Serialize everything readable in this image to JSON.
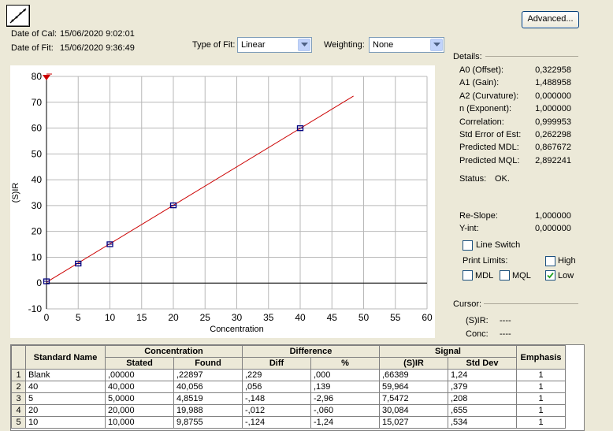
{
  "header": {
    "date_of_cal_label": "Date of Cal:",
    "date_of_cal": "15/06/2020 9:02:01",
    "date_of_fit_label": "Date of Fit:",
    "date_of_fit": "15/06/2020 9:36:49",
    "type_of_fit_label": "Type of Fit:",
    "type_of_fit": "Linear",
    "weighting_label": "Weighting:",
    "weighting": "None",
    "advanced_button": "Advanced..."
  },
  "details": {
    "title": "Details:",
    "rows": [
      {
        "label": "A0 (Offset):",
        "value": "0,322958"
      },
      {
        "label": "A1 (Gain):",
        "value": "1,488958"
      },
      {
        "label": "A2 (Curvature):",
        "value": "0,000000"
      },
      {
        "label": "n (Exponent):",
        "value": "1,000000"
      },
      {
        "label": "Correlation:",
        "value": "0,999953"
      },
      {
        "label": "Std Error of Est:",
        "value": "0,262298"
      },
      {
        "label": "Predicted MDL:",
        "value": "0,867672"
      },
      {
        "label": "Predicted MQL:",
        "value": "2,892241"
      }
    ],
    "status_label": "Status:",
    "status_value": "OK.",
    "reslope_label": "Re-Slope:",
    "reslope_value": "1,000000",
    "yint_label": "Y-int:",
    "yint_value": "0,000000",
    "line_switch_label": "Line Switch",
    "line_switch_checked": false,
    "print_limits_label": "Print Limits:",
    "high_label": "High",
    "high_checked": false,
    "mdl_label": "MDL",
    "mdl_checked": false,
    "mql_label": "MQL",
    "mql_checked": false,
    "low_label": "Low",
    "low_checked": true
  },
  "cursor": {
    "title": "Cursor:",
    "sir_label": "(S)IR:",
    "sir_value": "----",
    "conc_label": "Conc:",
    "conc_value": "----"
  },
  "chart_data": {
    "type": "scatter",
    "xlabel": "Concentration",
    "ylabel": "(S)IR",
    "xlim": [
      0,
      60
    ],
    "ylim": [
      -10,
      80
    ],
    "xticks": [
      0,
      5,
      10,
      15,
      20,
      25,
      30,
      35,
      40,
      45,
      50,
      55,
      60
    ],
    "yticks": [
      -10,
      0,
      10,
      20,
      30,
      40,
      50,
      60,
      70,
      80
    ],
    "grid": true,
    "points": [
      {
        "x": 0,
        "y": 0.66
      },
      {
        "x": 5,
        "y": 7.55
      },
      {
        "x": 10,
        "y": 15.03
      },
      {
        "x": 20,
        "y": 30.08
      },
      {
        "x": 40,
        "y": 59.96
      }
    ],
    "fit_line": {
      "x": [
        0,
        48.4
      ],
      "y": [
        0.32,
        72.4
      ]
    },
    "line_color": "#cc0000",
    "point_color": "#000080"
  },
  "table": {
    "group_headers": {
      "concentration": "Concentration",
      "difference": "Difference",
      "signal": "Signal"
    },
    "columns": {
      "standard_name": "Standard Name",
      "stated": "Stated",
      "found": "Found",
      "diff": "Diff",
      "pct": "%",
      "sir": "(S)IR",
      "std_dev": "Std Dev",
      "emphasis": "Emphasis"
    },
    "rows": [
      {
        "n": "1",
        "name": "Blank",
        "stated": ",00000",
        "found": ",22897",
        "diff": ",229",
        "pct": ",000",
        "sir": ",66389",
        "std": "1,24",
        "emph": "1"
      },
      {
        "n": "2",
        "name": "40",
        "stated": "40,000",
        "found": "40,056",
        "diff": ",056",
        "pct": ",139",
        "sir": "59,964",
        "std": ",379",
        "emph": "1"
      },
      {
        "n": "3",
        "name": "5",
        "stated": "5,0000",
        "found": "4,8519",
        "diff": "-,148",
        "pct": "-2,96",
        "sir": "7,5472",
        "std": ",208",
        "emph": "1"
      },
      {
        "n": "4",
        "name": "20",
        "stated": "20,000",
        "found": "19,988",
        "diff": "-,012",
        "pct": "-,060",
        "sir": "30,084",
        "std": ",655",
        "emph": "1"
      },
      {
        "n": "5",
        "name": "10",
        "stated": "10,000",
        "found": "9,8755",
        "diff": "-,124",
        "pct": "-1,24",
        "sir": "15,027",
        "std": ",534",
        "emph": "1"
      }
    ]
  }
}
